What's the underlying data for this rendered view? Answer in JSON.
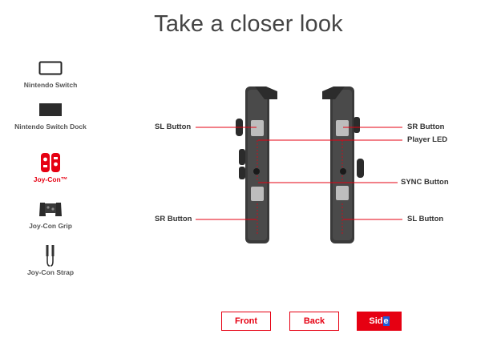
{
  "page": {
    "title": "Take a closer look"
  },
  "sidebar": {
    "items": [
      {
        "label": "Nintendo Switch",
        "icon": "switch-console-icon",
        "active": false
      },
      {
        "label": "Nintendo Switch Dock",
        "icon": "dock-icon",
        "active": false
      },
      {
        "label": "Joy-Con™",
        "icon": "joy-con-icon",
        "active": true
      },
      {
        "label": "Joy-Con Grip",
        "icon": "joy-con-grip-icon",
        "active": false
      },
      {
        "label": "Joy-Con Strap",
        "icon": "joy-con-strap-icon",
        "active": false
      }
    ]
  },
  "callouts": {
    "left": [
      {
        "label": "SL Button"
      },
      {
        "label": "SR Button"
      }
    ],
    "right": [
      {
        "label": "SR Button"
      },
      {
        "label": "Player LED"
      },
      {
        "label": "SYNC Button"
      },
      {
        "label": "SL Button"
      }
    ]
  },
  "views": {
    "front_label": "Front",
    "back_label": "Back",
    "side_label_a": "Sid",
    "side_label_b": "e",
    "active": "Side"
  },
  "colors": {
    "accent": "#e60012",
    "text": "#333333",
    "controller": "#3a3a3a"
  }
}
